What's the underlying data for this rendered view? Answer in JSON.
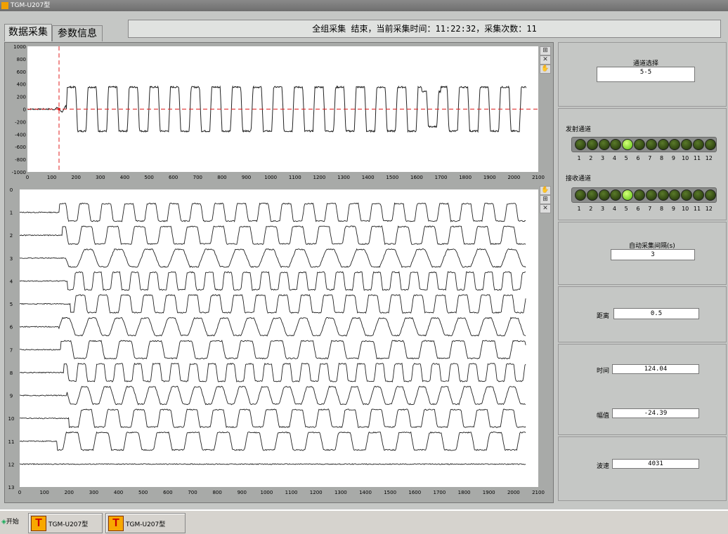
{
  "window": {
    "title": "TGM-U207型"
  },
  "tabs": [
    {
      "label": "数据采集"
    },
    {
      "label": "参数信息"
    }
  ],
  "status_text": "全组采集 结束，当前采集时间：11:22:32，采集次数：11",
  "top_chart": {
    "x_ticks": [
      "0",
      "100",
      "200",
      "300",
      "400",
      "500",
      "600",
      "700",
      "800",
      "900",
      "1000",
      "1100",
      "1200",
      "1300",
      "1400",
      "1500",
      "1600",
      "1700",
      "1800",
      "1900",
      "2000",
      "2100"
    ],
    "y_ticks": [
      "1000",
      "800",
      "600",
      "400",
      "200",
      "0",
      "-200",
      "-400",
      "-600",
      "-800",
      "-1000"
    ],
    "xlim": [
      0,
      2100
    ],
    "ylim": [
      -1000,
      1000
    ],
    "cursor_x": 130,
    "cursor_y": 0,
    "cursor_color": "#e02020"
  },
  "bottom_chart": {
    "x_ticks": [
      "0",
      "100",
      "200",
      "300",
      "400",
      "500",
      "600",
      "700",
      "800",
      "900",
      "1000",
      "1100",
      "1200",
      "1300",
      "1400",
      "1500",
      "1600",
      "1700",
      "1800",
      "1900",
      "2000",
      "2100"
    ],
    "y_ticks": [
      "0",
      "1",
      "2",
      "3",
      "4",
      "5",
      "6",
      "7",
      "8",
      "9",
      "10",
      "11",
      "12",
      "13"
    ],
    "xlim": [
      0,
      2100
    ],
    "ylim": [
      0,
      13
    ]
  },
  "chart_data": [
    {
      "type": "line",
      "xlim": [
        0,
        2100
      ],
      "ylim": [
        -1000,
        1000
      ],
      "series": [
        {
          "x_start": 0,
          "x_end": 2050
        }
      ],
      "cursor": {
        "x": 130,
        "y": 0
      }
    },
    {
      "type": "line",
      "xlim": [
        0,
        2100
      ],
      "ylim": [
        0,
        13
      ],
      "series_count": 12
    }
  ],
  "right_panel": {
    "channel_select_label": "通道选择",
    "channel_select_value": "5-5",
    "tx_label": "发射通道",
    "rx_label": "接收通道",
    "led_numbers": [
      "1",
      "2",
      "3",
      "4",
      "5",
      "6",
      "7",
      "8",
      "9",
      "10",
      "11",
      "12"
    ],
    "tx_active": 5,
    "rx_active": 5,
    "auto_interval_label": "自动采集间隔(s)",
    "auto_interval_value": "3",
    "distance_label": "距离",
    "distance_value": "0.5",
    "time_label": "时间",
    "time_value": "124.04",
    "amplitude_label": "幅值",
    "amplitude_value": "-24.39",
    "velocity_label": "波速",
    "velocity_value": "4031"
  },
  "taskbar": {
    "start_label": "开始",
    "items": [
      {
        "label": "TGM-U207型",
        "icon_text": "T"
      },
      {
        "label": "TGM-U207型",
        "icon_text": "T"
      }
    ]
  },
  "tool_icons": [
    "zoom-icon",
    "pan-icon",
    "hand-icon"
  ]
}
